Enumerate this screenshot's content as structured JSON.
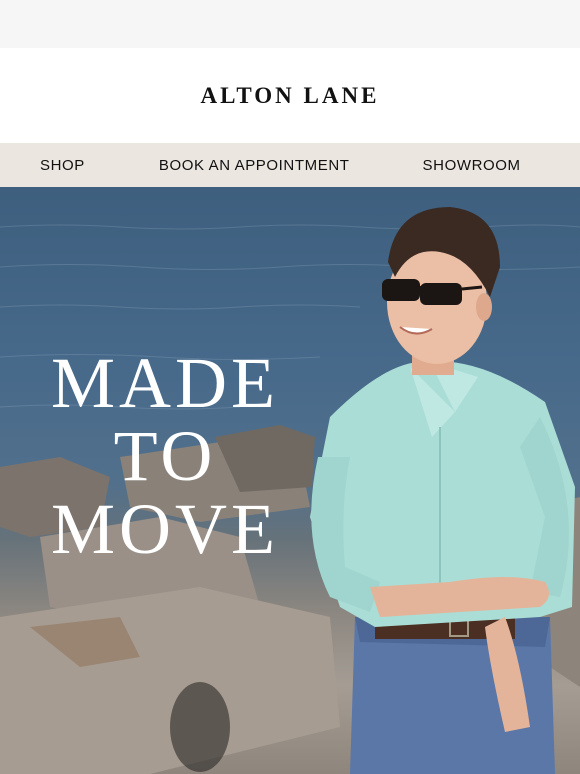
{
  "brand": {
    "name": "ALTON LANE"
  },
  "nav": {
    "items": [
      {
        "label": "SHOP"
      },
      {
        "label": "BOOK AN APPOINTMENT"
      },
      {
        "label": "SHOWROOM"
      }
    ]
  },
  "hero": {
    "headline": [
      "MADE",
      "TO",
      "MOVE"
    ],
    "photo_subject": "man in mint linen shirt and sunglasses on rocks by the water"
  },
  "colors": {
    "nav_background": "#ebe6e0",
    "shirt": "#a9ddd6",
    "water": "#46688a"
  }
}
